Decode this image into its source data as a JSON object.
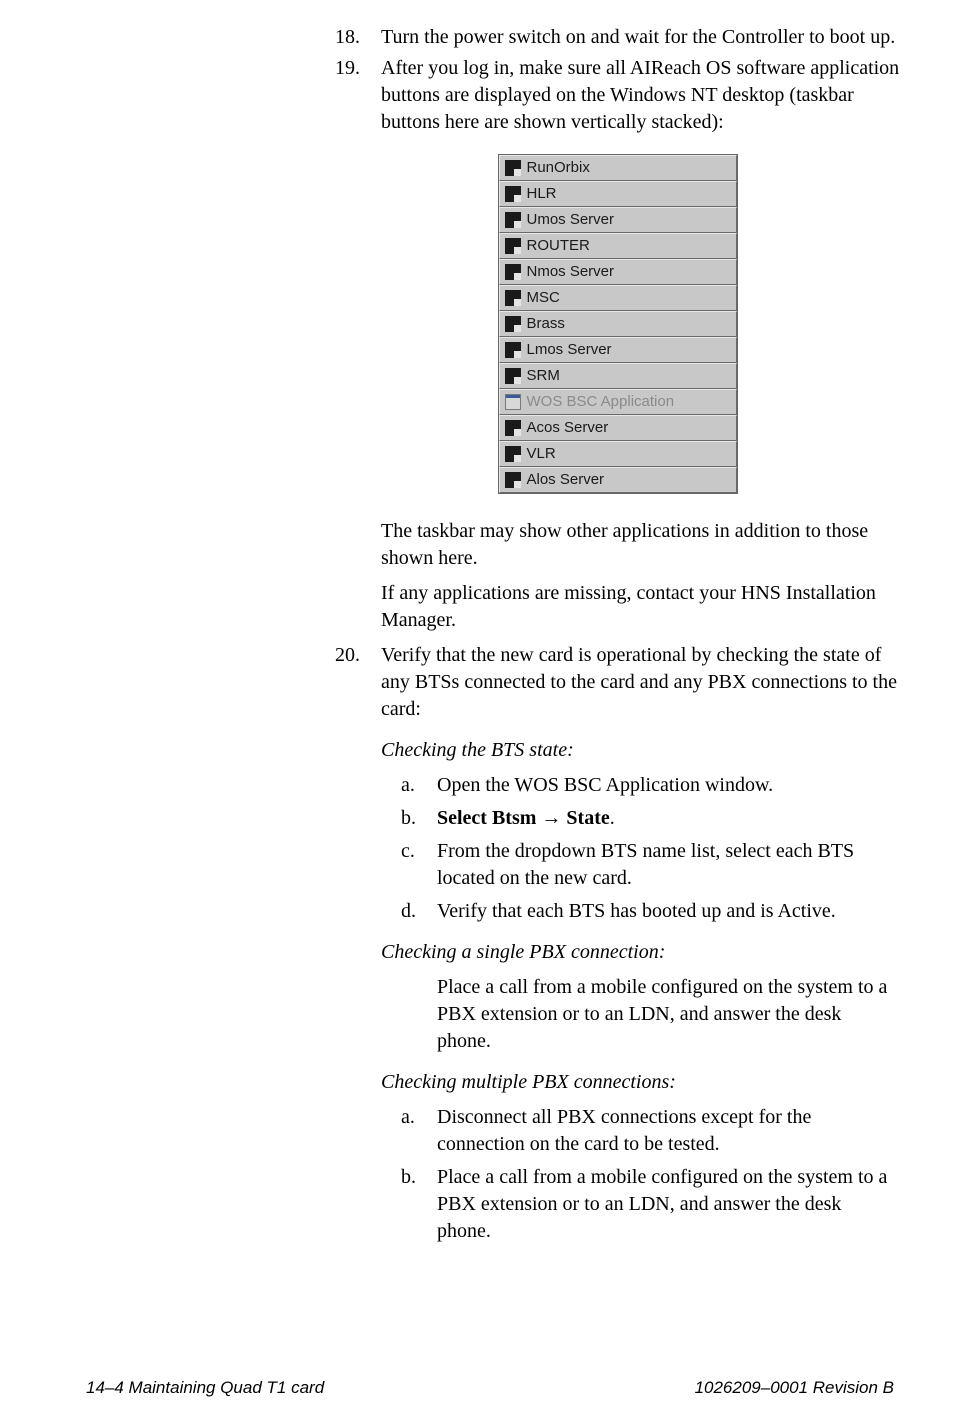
{
  "steps": {
    "s18": {
      "num": "18.",
      "text": "Turn the power switch on and wait for the Controller to boot up."
    },
    "s19": {
      "num": "19.",
      "text": "After you log in, make sure all AIReach OS software application buttons are displayed on the Windows NT desktop (taskbar buttons here are shown vertically stacked):"
    },
    "s19_note1": "The taskbar may show other applications in addition to those shown here.",
    "s19_note2": "If any applications are missing, contact your HNS Installation Manager.",
    "s20": {
      "num": "20.",
      "text": "Verify that the new card is operational by checking the state of any BTSs connected to the card and any PBX connections to the card:"
    }
  },
  "taskbar": [
    {
      "label": "RunOrbix",
      "icon": "term",
      "disabled": false
    },
    {
      "label": "HLR",
      "icon": "term",
      "disabled": false
    },
    {
      "label": "Umos Server",
      "icon": "term",
      "disabled": false
    },
    {
      "label": "ROUTER",
      "icon": "term",
      "disabled": false
    },
    {
      "label": "Nmos Server",
      "icon": "term",
      "disabled": false
    },
    {
      "label": "MSC",
      "icon": "term",
      "disabled": false
    },
    {
      "label": "Brass",
      "icon": "term",
      "disabled": false
    },
    {
      "label": "Lmos Server",
      "icon": "term",
      "disabled": false
    },
    {
      "label": "SRM",
      "icon": "term",
      "disabled": false
    },
    {
      "label": "WOS BSC Application",
      "icon": "win",
      "disabled": true
    },
    {
      "label": "Acos Server",
      "icon": "term",
      "disabled": false
    },
    {
      "label": "VLR",
      "icon": "term",
      "disabled": false
    },
    {
      "label": "Alos Server",
      "icon": "term",
      "disabled": false
    }
  ],
  "bts": {
    "heading": "Checking the BTS state:",
    "a": {
      "letter": "a.",
      "text": "Open the WOS BSC Application window."
    },
    "b": {
      "letter": "b.",
      "pre": "Select Btsm ",
      "arrow": "→",
      "post": " State",
      "period": "."
    },
    "c": {
      "letter": "c.",
      "text": "From the dropdown BTS name list, select each BTS located on the new card."
    },
    "d": {
      "letter": "d.",
      "text": "Verify that each BTS has booted up and is Active."
    }
  },
  "single_pbx": {
    "heading": "Checking a single PBX connection:",
    "text": "Place a call from a mobile configured on the system to a PBX extension or to an LDN, and answer the desk phone."
  },
  "multi_pbx": {
    "heading": "Checking multiple PBX connections:",
    "a": {
      "letter": "a.",
      "text": "Disconnect all PBX connections except for the connection on the card to be tested."
    },
    "b": {
      "letter": "b.",
      "text": "Place a call from a mobile configured on the system to a PBX extension or to an LDN, and answer the desk phone."
    }
  },
  "footer": {
    "left": "14–4  Maintaining Quad T1 card",
    "right": "1026209–0001  Revision B"
  }
}
